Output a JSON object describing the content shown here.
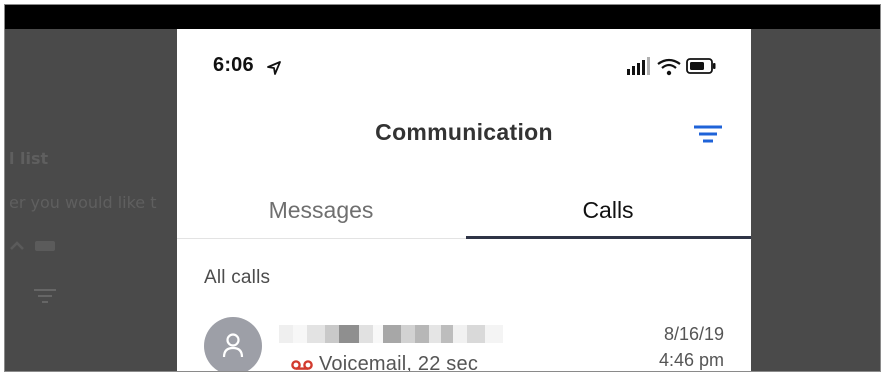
{
  "status_bar": {
    "time": "6:06",
    "icons": [
      "location-arrow-icon",
      "signal-icon",
      "wifi-icon",
      "battery-icon"
    ]
  },
  "header": {
    "title": "Communication",
    "filter_icon": "filter-icon"
  },
  "tabs": [
    {
      "label": "Messages",
      "selected": false
    },
    {
      "label": "Calls",
      "selected": true
    }
  ],
  "section": {
    "label": "All calls"
  },
  "calls": [
    {
      "avatar_icon": "person-icon",
      "type_icon": "voicemail-icon",
      "detail": "Voicemail, 22 sec",
      "date": "8/16/19",
      "time": "4:46 pm"
    }
  ],
  "background_page": {
    "title_fragment": "l list",
    "subtitle_fragment": "er you would like t"
  },
  "colors": {
    "accent": "#1f63d8",
    "voicemail": "#d23b2e",
    "tab_underline": "#2f3446",
    "avatar": "#9d9fa7",
    "overlay": "#4a4a4a"
  }
}
